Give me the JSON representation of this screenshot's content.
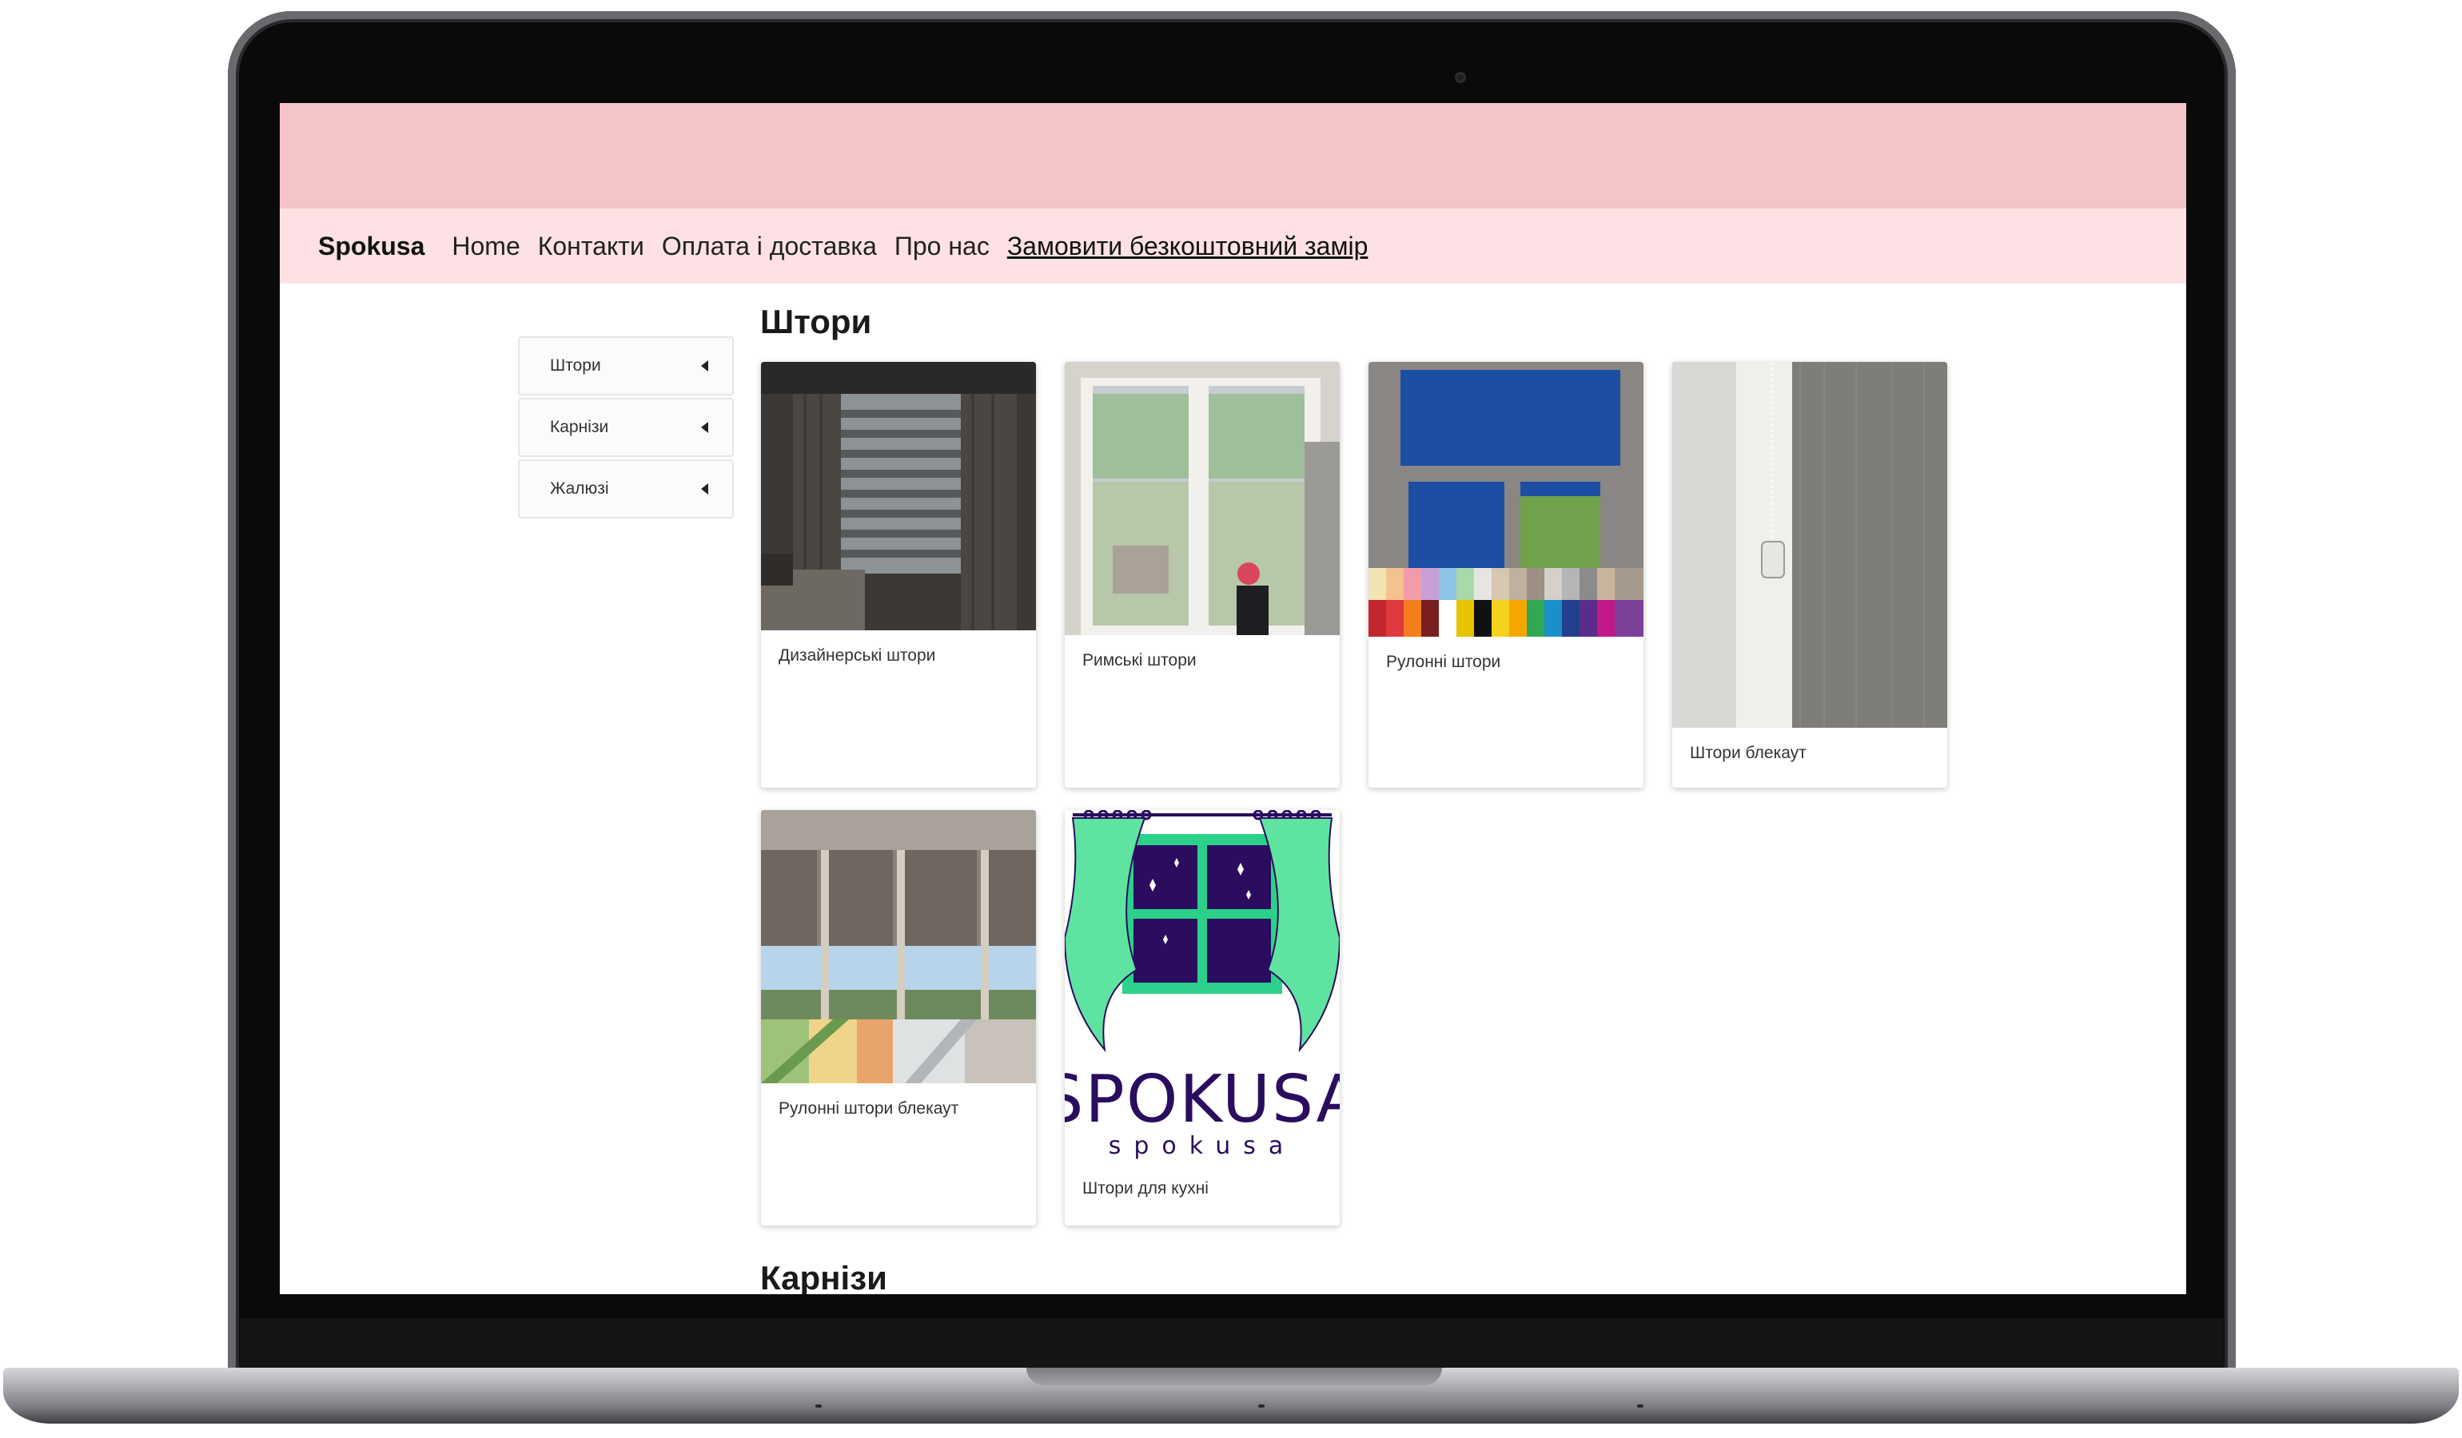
{
  "navbar": {
    "brand": "Spokusa",
    "links": [
      "Home",
      "Контакти",
      "Оплата і доставка",
      "Про нас"
    ],
    "cta": "Замовити безкоштовний замір"
  },
  "sidebar": {
    "items": [
      {
        "label": "Штори"
      },
      {
        "label": "Карнізи"
      },
      {
        "label": "Жалюзі"
      }
    ]
  },
  "sections": {
    "curtains_title": "Штори",
    "cornices_title": "Карнізи"
  },
  "cards": [
    {
      "title": "Дизайнерські штори"
    },
    {
      "title": "Римські штори"
    },
    {
      "title": "Рулонні штори"
    },
    {
      "title": "Штори блекаут"
    },
    {
      "title": "Рулонні штори блекаут"
    },
    {
      "title": "Штори для кухні"
    }
  ],
  "logo": {
    "main": "SPOKUSA",
    "sub": "spokusa"
  },
  "colors": {
    "banner": "#f5c4c9",
    "navbar": "#fde1e4",
    "logo_text": "#2a0d5e",
    "logo_curtain": "#5ee4a0",
    "logo_window": "#2a0d5e"
  }
}
